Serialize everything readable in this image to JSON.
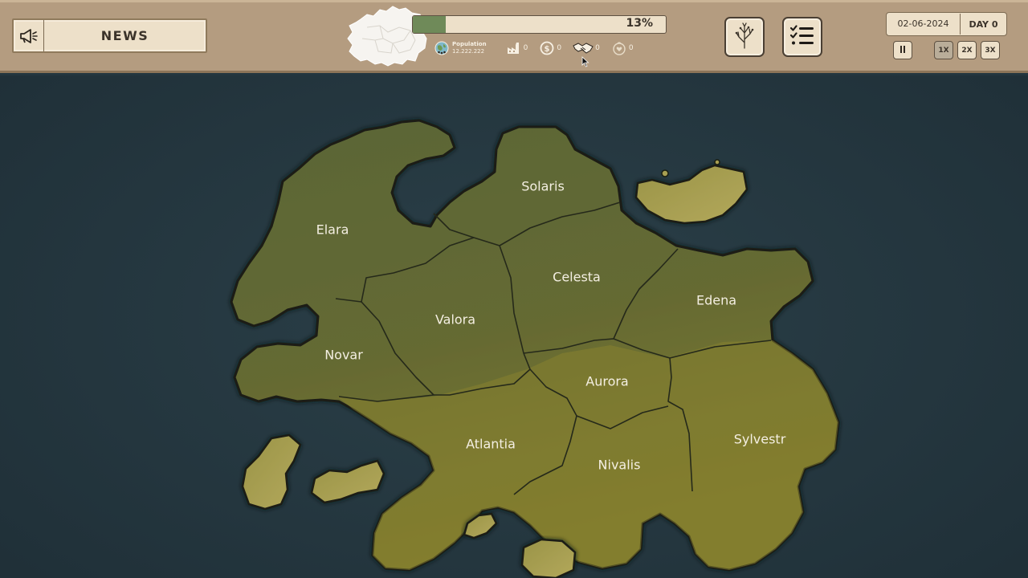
{
  "header": {
    "news_label": "NEWS",
    "progress_percent": 13,
    "progress_text": "13%",
    "population_label": "Population",
    "population_value": "12.222.222",
    "industry_value": "0",
    "economy_value": "0",
    "diplomacy_value": "0",
    "happiness_value": "0",
    "date": "02-06-2024",
    "day": "DAY 0"
  },
  "speed_controls": {
    "pause_icon": "pause-icon",
    "speeds": [
      "1X",
      "2X",
      "3X"
    ],
    "active": "1X"
  },
  "icons": {
    "news": "megaphone-icon",
    "population": "globe-icon",
    "industry": "factory-icon",
    "economy": "coin-icon",
    "diplomacy": "handshake-icon",
    "happiness": "heart-icon",
    "tree": "tech-tree-icon",
    "tasks": "checklist-icon"
  },
  "colors": {
    "sea": "#24363f",
    "land_dark": "#5e6a38",
    "land_yellow": "#7e7a34",
    "progress_fill": "#6f8a59",
    "panel": "#ede0c9",
    "bar": "#b49c80"
  },
  "map": {
    "regions": [
      "Solaris",
      "Elara",
      "Celesta",
      "Valora",
      "Edena",
      "Novar",
      "Aurora",
      "Atlantia",
      "Sylvestr",
      "Nivalis"
    ]
  }
}
